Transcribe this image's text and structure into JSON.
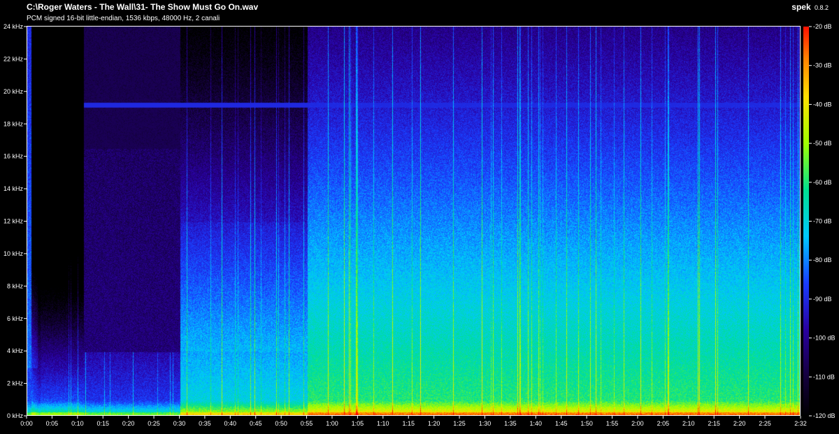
{
  "header": {
    "file_title": "C:\\Roger Waters - The Wall\\31- The Show Must Go On.wav",
    "file_info": "PCM signed 16-bit little-endian, 1536 kbps, 48000 Hz, 2 canali",
    "app_name": "spek",
    "app_version": "0.8.2"
  },
  "colors": {
    "background": "#000000",
    "text": "#ffffff",
    "palette": [
      "#000000",
      "#14003c",
      "#2a00a0",
      "#1a3cff",
      "#00c8ff",
      "#00e090",
      "#a0ff00",
      "#ffe000",
      "#ff8000",
      "#ff1000"
    ]
  },
  "chart_data": {
    "type": "heatmap",
    "y_axis": {
      "ticks": [
        "0 kHz",
        "2 kHz",
        "4 kHz",
        "6 kHz",
        "8 kHz",
        "10 kHz",
        "12 kHz",
        "14 kHz",
        "16 kHz",
        "18 kHz",
        "20 kHz",
        "22 kHz",
        "24 kHz"
      ],
      "range_khz": [
        0,
        24
      ]
    },
    "x_axis": {
      "ticks": [
        "0:00",
        "0:05",
        "0:10",
        "0:15",
        "0:20",
        "0:25",
        "0:30",
        "0:35",
        "0:40",
        "0:45",
        "0:50",
        "0:55",
        "1:00",
        "1:05",
        "1:10",
        "1:15",
        "1:20",
        "1:25",
        "1:30",
        "1:35",
        "1:40",
        "1:45",
        "1:50",
        "1:55",
        "2:00",
        "2:05",
        "2:10",
        "2:15",
        "2:20",
        "2:25"
      ],
      "end_label": "2:32",
      "range_seconds": [
        0,
        152
      ]
    },
    "color_scale": {
      "ticks": [
        "-20 dB",
        "-30 dB",
        "-40 dB",
        "-50 dB",
        "-60 dB",
        "-70 dB",
        "-80 dB",
        "-90 dB",
        "-100 dB",
        "-110 dB",
        "-120 dB"
      ],
      "range_db": [
        -120,
        -20
      ]
    },
    "tonal_line_khz": 19.2,
    "tonal_line_starts_seconds": 11
  }
}
